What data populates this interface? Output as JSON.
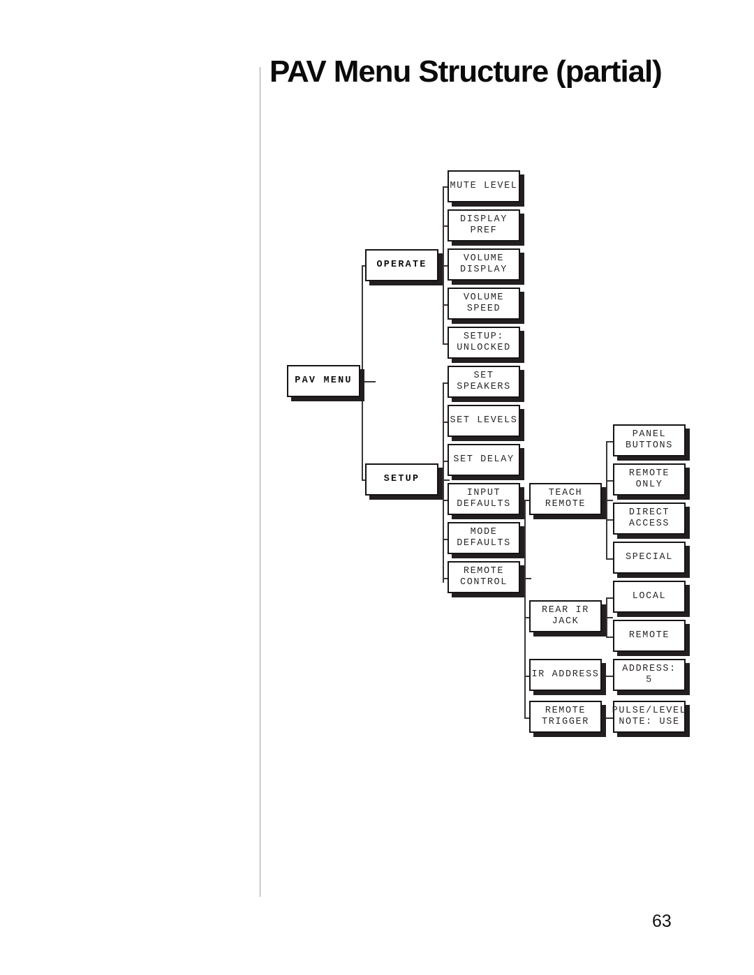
{
  "page": {
    "title": "PAV Menu Structure (partial)",
    "folio": "63"
  },
  "diagram": {
    "type": "menu-tree",
    "root": {
      "label": "PAV MENU"
    },
    "level1": [
      {
        "label": "OPERATE"
      },
      {
        "label": "SETUP"
      }
    ],
    "operate_children": [
      {
        "label": "MUTE LEVEL"
      },
      {
        "label": "DISPLAY\nPREF"
      },
      {
        "label": "VOLUME\nDISPLAY"
      },
      {
        "label": "VOLUME\nSPEED"
      },
      {
        "label": "SETUP:\nUNLOCKED"
      }
    ],
    "setup_children": [
      {
        "label": "SET\nSPEAKERS"
      },
      {
        "label": "SET LEVELS"
      },
      {
        "label": "SET DELAY"
      },
      {
        "label": "INPUT\nDEFAULTS"
      },
      {
        "label": "MODE\nDEFAULTS"
      },
      {
        "label": "REMOTE\nCONTROL"
      }
    ],
    "remote_control_children": [
      {
        "label": "TEACH\nREMOTE"
      },
      {
        "label": "REAR IR\nJACK"
      },
      {
        "label": "IR ADDRESS"
      },
      {
        "label": "REMOTE\nTRIGGER"
      }
    ],
    "teach_remote_children": [
      {
        "label": "PANEL\nBUTTONS"
      },
      {
        "label": "REMOTE\nONLY"
      },
      {
        "label": "DIRECT\nACCESS"
      },
      {
        "label": "SPECIAL"
      }
    ],
    "rear_ir_jack_children": [
      {
        "label": "LOCAL"
      },
      {
        "label": "REMOTE"
      }
    ],
    "ir_address_children": [
      {
        "label": "ADDRESS:\n5"
      }
    ],
    "remote_trigger_children": [
      {
        "label": "PULSE/LEVEL\nNOTE: USE"
      }
    ]
  }
}
